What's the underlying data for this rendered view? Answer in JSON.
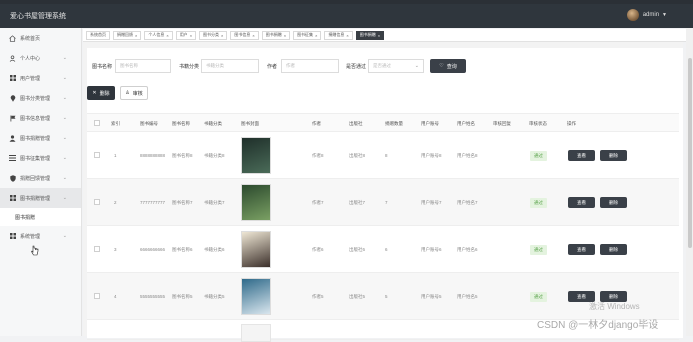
{
  "app": {
    "title": "爱心书屋管理系统"
  },
  "user": {
    "name": "admin"
  },
  "sidebar": {
    "items": [
      {
        "label": "系统首页",
        "icon": "home-icon",
        "chevron": false
      },
      {
        "label": "个人中心",
        "icon": "person-icon",
        "chevron": true
      },
      {
        "label": "用户管理",
        "icon": "grid-icon",
        "chevron": true
      },
      {
        "label": "图书分类管理",
        "icon": "pin-icon",
        "chevron": true
      },
      {
        "label": "图书信息管理",
        "icon": "flag-icon",
        "chevron": true
      },
      {
        "label": "图书捐赠管理",
        "icon": "user-icon",
        "chevron": true
      },
      {
        "label": "图书征集管理",
        "icon": "list-icon",
        "chevron": true
      },
      {
        "label": "捐赠回馈管理",
        "icon": "shield-icon",
        "chevron": true
      },
      {
        "label": "图书捐赠管理",
        "icon": "grid-icon",
        "chevron": true,
        "active": true
      }
    ],
    "submenu": "图书捐赠",
    "system": {
      "label": "系统管理",
      "icon": "grid-icon"
    }
  },
  "tabs": [
    {
      "label": "系统首页",
      "close": false
    },
    {
      "label": "捐赠回馈",
      "close": true
    },
    {
      "label": "个人信息",
      "close": true
    },
    {
      "label": "用户",
      "close": true
    },
    {
      "label": "图书分类",
      "close": true
    },
    {
      "label": "图书信息",
      "close": true
    },
    {
      "label": "图书捐赠",
      "close": true
    },
    {
      "label": "图书征集",
      "close": true
    },
    {
      "label": "捐赠信息",
      "close": true
    },
    {
      "label": "图书捐赠",
      "close": true,
      "active": true
    }
  ],
  "search": {
    "name_label": "图书名称",
    "name_placeholder": "图书名称",
    "category_label": "书籍分类",
    "category_placeholder": "书籍分类",
    "author_label": "作者",
    "author_placeholder": "作者",
    "pass_label": "是否通过",
    "pass_placeholder": "是否通过",
    "query_label": "查询"
  },
  "actions": {
    "delete_label": "删除",
    "audit_label": "审核"
  },
  "table": {
    "headers": [
      "索引",
      "图书编号",
      "图书名称",
      "书籍分类",
      "图书封面",
      "作者",
      "出版社",
      "捐赠数量",
      "用户账号",
      "用户姓名",
      "审核回复",
      "审核状态",
      "操作"
    ],
    "rows": [
      {
        "index": "1",
        "code": "8888888888",
        "name": "图书名称8",
        "category": "书籍分类8",
        "author": "作者8",
        "publisher": "出版社8",
        "qty": "8",
        "account": "用户账号8",
        "uname": "用户姓名8",
        "reply": "",
        "status": "通过",
        "cover": [
          "#1f2f2a",
          "#4a6b58"
        ]
      },
      {
        "index": "2",
        "code": "7777777777",
        "name": "图书名称7",
        "category": "书籍分类7",
        "author": "作者7",
        "publisher": "出版社7",
        "qty": "7",
        "account": "用户账号7",
        "uname": "用户姓名7",
        "reply": "",
        "status": "通过",
        "cover": [
          "#2c4a2e",
          "#7aa063"
        ]
      },
      {
        "index": "3",
        "code": "6666666666",
        "name": "图书名称6",
        "category": "书籍分类6",
        "author": "作者6",
        "publisher": "出版社6",
        "qty": "6",
        "account": "用户账号6",
        "uname": "用户姓名6",
        "reply": "",
        "status": "通过",
        "cover": [
          "#efe7d5",
          "#3b2f2a"
        ]
      },
      {
        "index": "4",
        "code": "5555555555",
        "name": "图书名称5",
        "category": "书籍分类5",
        "author": "作者5",
        "publisher": "出版社5",
        "qty": "5",
        "account": "用户账号5",
        "uname": "用户姓名5",
        "reply": "",
        "status": "通过",
        "cover": [
          "#2f6a8a",
          "#d9e6ee"
        ]
      }
    ],
    "view_label": "查看",
    "delete_label": "删除"
  },
  "watermark": {
    "windows": "激活 Windows",
    "csdn": "CSDN @一林夕django毕设"
  }
}
